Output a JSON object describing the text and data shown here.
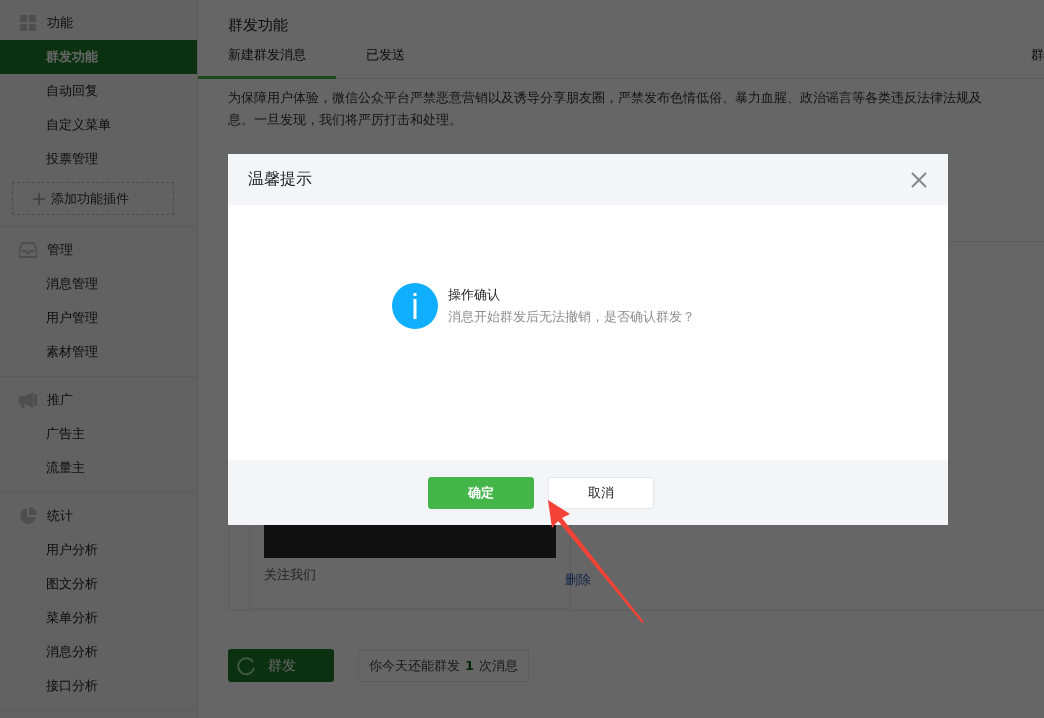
{
  "sidebar": {
    "sections": [
      {
        "title": "功能",
        "kind": "grid",
        "items": [
          {
            "label": "群发功能",
            "selected": true
          },
          {
            "label": "自动回复",
            "selected": false
          },
          {
            "label": "自定义菜单",
            "selected": false
          },
          {
            "label": "投票管理",
            "selected": false
          }
        ],
        "add_button": "添加功能插件"
      },
      {
        "title": "管理",
        "kind": "inbox",
        "items": [
          {
            "label": "消息管理",
            "selected": false
          },
          {
            "label": "用户管理",
            "selected": false
          },
          {
            "label": "素材管理",
            "selected": false
          }
        ]
      },
      {
        "title": "推广",
        "kind": "megaphone",
        "items": [
          {
            "label": "广告主",
            "selected": false
          },
          {
            "label": "流量主",
            "selected": false
          }
        ]
      },
      {
        "title": "统计",
        "kind": "pie",
        "items": [
          {
            "label": "用户分析",
            "selected": false
          },
          {
            "label": "图文分析",
            "selected": false
          },
          {
            "label": "菜单分析",
            "selected": false
          },
          {
            "label": "消息分析",
            "selected": false
          },
          {
            "label": "接口分析",
            "selected": false
          }
        ]
      }
    ]
  },
  "main": {
    "title": "群发功能",
    "tabs": [
      {
        "label": "新建群发消息",
        "selected": true
      },
      {
        "label": "已发送",
        "selected": false
      }
    ],
    "right_link": "群",
    "notice": [
      "为保障用户体验，微信公众平台严禁恶意营销以及诱导分享朋友圈，严禁发布色情低俗、暴力血腥、政治谣言等各类违反法律法规及",
      "息。一旦发现，我们将严厉打击和处理。"
    ],
    "article": {
      "caption": "关注我们",
      "delete_link": "删除"
    },
    "send_button": {
      "label": "群发",
      "loading": true
    },
    "quota": {
      "prefix": "你今天还能群发",
      "count": "1",
      "suffix": "次消息"
    }
  },
  "dialog": {
    "title": "温馨提示",
    "heading": "操作确认",
    "message": "消息开始群发后无法撤销，是否确认群发？",
    "buttons": [
      {
        "label": "确定",
        "kind": "primary"
      },
      {
        "label": "取消",
        "kind": "default"
      }
    ]
  }
}
